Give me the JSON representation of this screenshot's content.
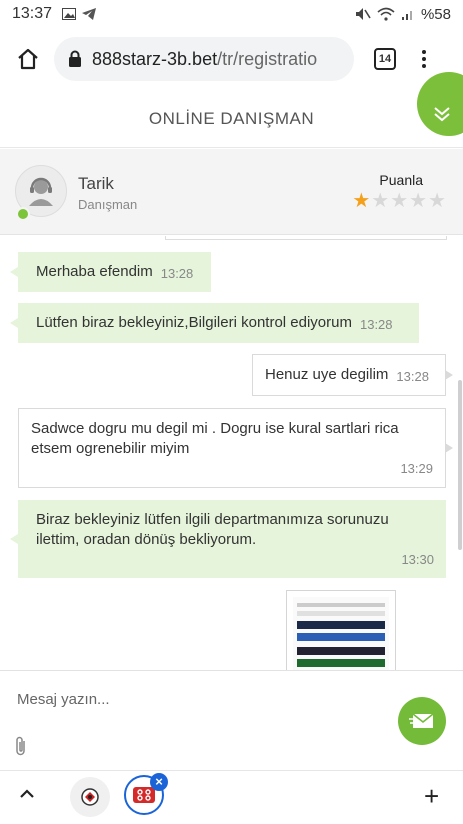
{
  "status_bar": {
    "time": "13:37",
    "battery": "%58"
  },
  "browser": {
    "url_domain": "888starz-3b.bet",
    "url_path": "/tr/registratio",
    "tab_count": "14"
  },
  "chat": {
    "title": "ONLİNE DANIŞMAN",
    "agent": {
      "name": "Tarik",
      "role": "Danışman"
    },
    "rating": {
      "label": "Puanla",
      "value": 1,
      "max": 5
    },
    "messages": [
      {
        "from": "agent",
        "text": "Merhaba efendim",
        "time": "13:28"
      },
      {
        "from": "agent",
        "text": "Lütfen biraz bekleyiniz,Bilgileri kontrol ediyorum",
        "time": "13:28"
      },
      {
        "from": "user",
        "text": "Henuz uye degilim",
        "time": "13:28"
      },
      {
        "from": "user",
        "text": "Sadwce dogru mu degil mi . Dogru ise kural sartlari rica etsem ogrenebilir miyim",
        "time": "13:29"
      },
      {
        "from": "agent",
        "text": "Biraz bekleyiniz lütfen ilgili departmanımıza sorunuzu ilettim, oradan dönüş bekliyorum.",
        "time": "13:30"
      }
    ],
    "composer_placeholder": "Mesaj yazın..."
  },
  "colors": {
    "accent_green": "#74bb3a",
    "agent_bubble": "#e5f4da",
    "star_on": "#f5a01a",
    "tab_blue": "#1a64d8"
  }
}
